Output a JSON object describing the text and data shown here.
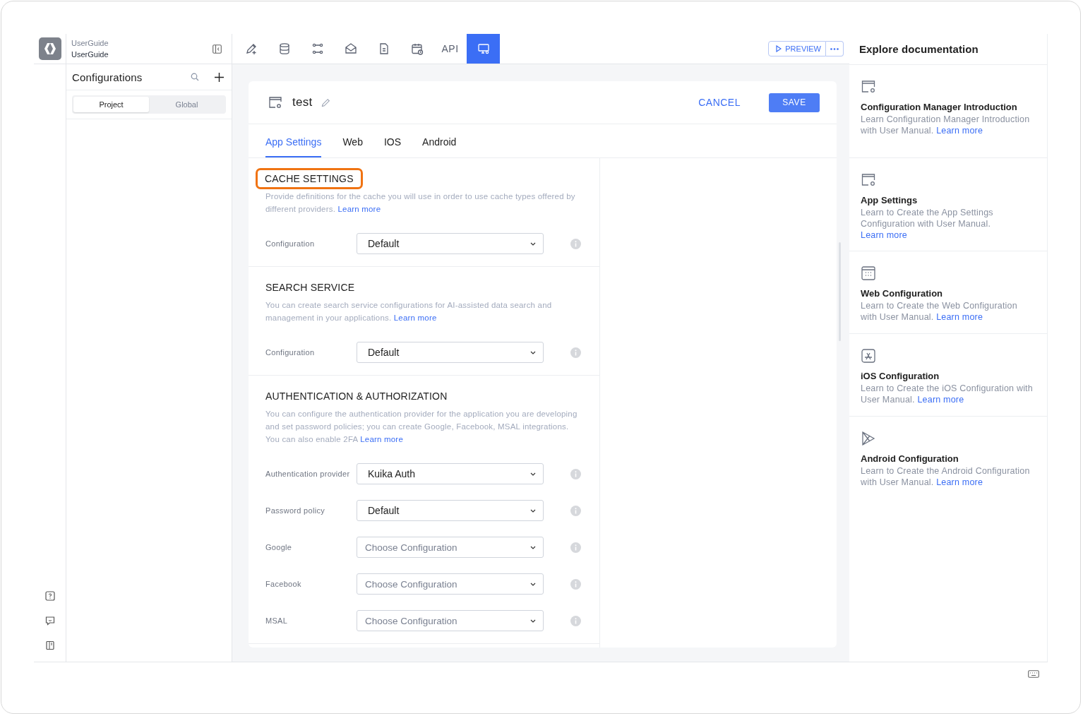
{
  "workspace": {
    "name": "UserGuide",
    "project": "UserGuide"
  },
  "toolbar": {
    "items": [
      {
        "kind": "icon",
        "selected": false
      },
      {
        "kind": "icon",
        "selected": false
      },
      {
        "kind": "icon",
        "selected": false
      },
      {
        "kind": "icon",
        "selected": false
      },
      {
        "kind": "icon",
        "selected": false
      },
      {
        "kind": "icon",
        "selected": false
      },
      {
        "kind": "text",
        "label": "API",
        "selected": false
      },
      {
        "kind": "icon",
        "selected": true
      }
    ],
    "preview": "PREVIEW"
  },
  "sidebar": {
    "title": "Configurations",
    "scopes": [
      {
        "label": "Project",
        "selected": true
      },
      {
        "label": "Global",
        "selected": false
      }
    ]
  },
  "editor": {
    "title": "test",
    "cancel": "CANCEL",
    "save": "SAVE",
    "tabs": [
      {
        "label": "App Settings",
        "selected": true
      },
      {
        "label": "Web",
        "selected": false
      },
      {
        "label": "IOS",
        "selected": false
      },
      {
        "label": "Android",
        "selected": false
      }
    ],
    "sections": [
      {
        "title": "CACHE SETTINGS",
        "highlighted": true,
        "description": "Provide definitions for the cache you will use in order to use cache types offered by different providers.",
        "link": "Learn more",
        "fields": [
          {
            "label": "Configuration",
            "value": "Default"
          }
        ]
      },
      {
        "title": "SEARCH SERVICE",
        "highlighted": false,
        "description": "You can create search service configurations for AI-assisted data search and management in your applications.",
        "link": "Learn more",
        "fields": [
          {
            "label": "Configuration",
            "value": "Default"
          }
        ]
      },
      {
        "title": "AUTHENTICATION & AUTHORIZATION",
        "highlighted": false,
        "description": "You can configure the authentication provider for the application you are developing and set password policies; you can create Google, Facebook, MSAL integrations. You can also enable 2FA",
        "link": "Learn more",
        "fields": [
          {
            "label": "Authentication provider",
            "value": "Kuika Auth"
          },
          {
            "label": "Password policy",
            "value": "Default"
          },
          {
            "label": "Google",
            "placeholder": "Choose Configuration"
          },
          {
            "label": "Facebook",
            "placeholder": "Choose Configuration"
          },
          {
            "label": "MSAL",
            "placeholder": "Choose Configuration"
          }
        ]
      }
    ]
  },
  "docs": {
    "title": "Explore documentation",
    "items": [
      {
        "title": "Configuration Manager Introduction",
        "description": "Learn Configuration Manager Introduction with User Manual.",
        "link": "Learn more"
      },
      {
        "title": "App Settings",
        "description": "Learn to Create the App Settings Configuration with User Manual.",
        "link": "Learn more"
      },
      {
        "title": "Web Configuration",
        "description": "Learn to Create the Web Configuration with User Manual.",
        "link": "Learn more"
      },
      {
        "title": "iOS Configuration",
        "description": "Learn to Create the iOS Configuration with User Manual.",
        "link": "Learn more"
      },
      {
        "title": "Android Configuration",
        "description": "Learn to Create the Android Configuration with User Manual.",
        "link": "Learn more"
      }
    ]
  }
}
